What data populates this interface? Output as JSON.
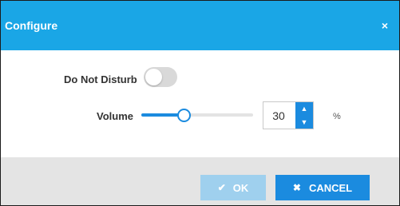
{
  "dialog": {
    "title": "Configure",
    "close_symbol": "×"
  },
  "settings": {
    "dnd_label": "Do Not Disturb",
    "dnd_enabled": false,
    "volume_label": "Volume",
    "volume_value": "30",
    "volume_fraction": 0.3,
    "volume_unit": "%",
    "step_up_symbol": "▲",
    "step_down_symbol": "▼"
  },
  "footer": {
    "ok_label": "OK",
    "ok_icon": "✔",
    "cancel_label": "CANCEL",
    "cancel_icon": "✖"
  },
  "colors": {
    "titlebar": "#1aa6e6",
    "accent": "#1b8bdf",
    "ok_disabled": "#9fd0ee",
    "footer_bg": "#e4e4e4",
    "toggle_off": "#d9d9d9"
  }
}
